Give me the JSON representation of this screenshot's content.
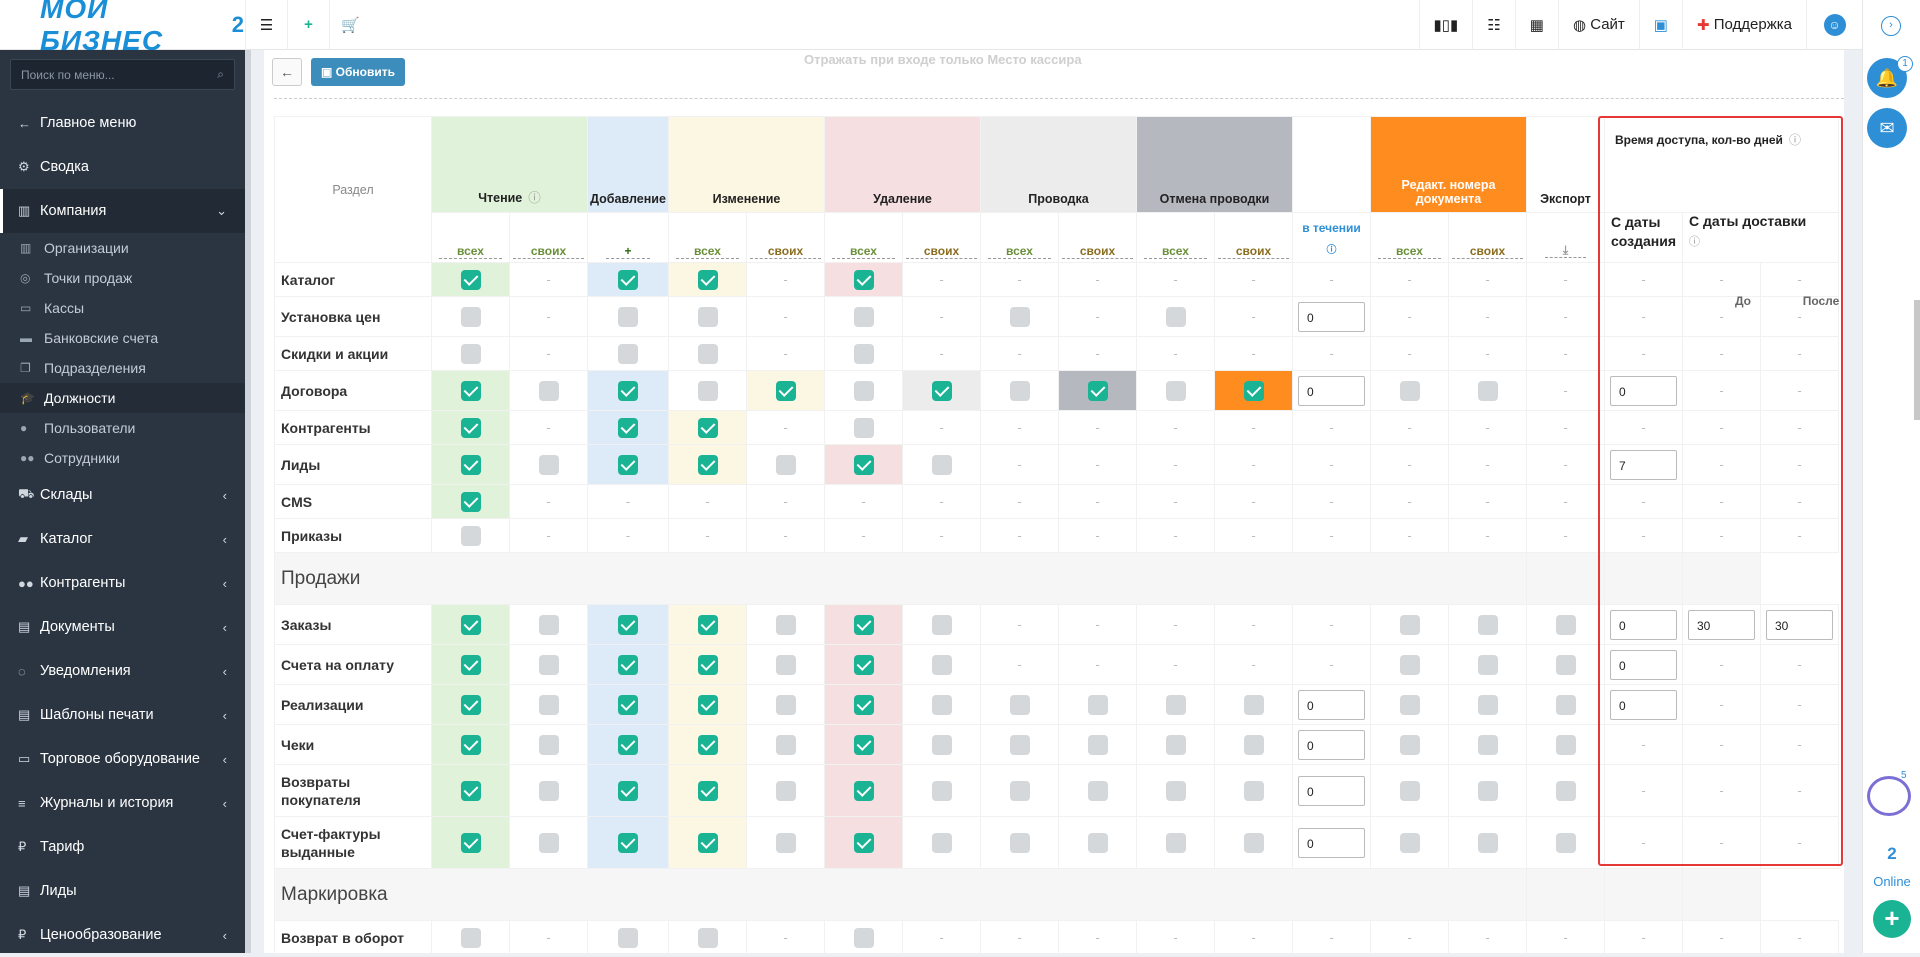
{
  "topbar": {
    "logo_text": "МОЙ БИЗНЕС",
    "logo_num": "2",
    "site": "Сайт",
    "support": "Поддержка"
  },
  "sidebar": {
    "search_placeholder": "Поиск по меню...",
    "items": [
      {
        "label": "Главное меню",
        "icon": "arrow-left-icon"
      },
      {
        "label": "Сводка",
        "icon": "gear-icon"
      },
      {
        "label": "Компания",
        "icon": "chart-icon",
        "active": true
      }
    ],
    "subitems": [
      {
        "label": "Организации",
        "icon": "building-icon"
      },
      {
        "label": "Точки продаж",
        "icon": "target-icon"
      },
      {
        "label": "Кассы",
        "icon": "cash-icon"
      },
      {
        "label": "Банковские счета",
        "icon": "card-icon"
      },
      {
        "label": "Подразделения",
        "icon": "copy-icon"
      },
      {
        "label": "Должности",
        "icon": "graduation-icon",
        "active": true
      },
      {
        "label": "Пользователи",
        "icon": "user-icon"
      },
      {
        "label": "Сотрудники",
        "icon": "users-icon"
      }
    ],
    "items2": [
      {
        "label": "Склады",
        "icon": "truck-icon"
      },
      {
        "label": "Каталог",
        "icon": "folder-icon"
      },
      {
        "label": "Контрагенты",
        "icon": "users-icon"
      },
      {
        "label": "Документы",
        "icon": "document-icon"
      },
      {
        "label": "Уведомления",
        "icon": "chat-icon"
      },
      {
        "label": "Шаблоны печати",
        "icon": "template-icon"
      },
      {
        "label": "Торговое оборудование",
        "icon": "inbox-icon"
      },
      {
        "label": "Журналы и история",
        "icon": "list-icon"
      },
      {
        "label": "Тариф",
        "icon": "ruble-icon"
      },
      {
        "label": "Лиды",
        "icon": "document-icon"
      },
      {
        "label": "Ценообразование",
        "icon": "ruble-icon"
      }
    ]
  },
  "toolbar": {
    "refresh": "Обновить",
    "faded": "Отражать при входе только Место кассира"
  },
  "table": {
    "h_section": "Раздел",
    "h_read": "Чтение",
    "h_add": "Добавление",
    "h_edit": "Изменение",
    "h_del": "Удаление",
    "h_post": "Проводка",
    "h_unpost": "Отмена проводки",
    "h_renum": "Редакт. номера документа",
    "h_export": "Экспорт",
    "h_access": "Время доступа, кол-во дней",
    "h_created": "С даты создания",
    "h_delivery": "С даты доставки",
    "s_all": "всех",
    "s_own": "своих",
    "s_within": "в течении",
    "s_before": "До",
    "s_after": "После",
    "dash": "-",
    "sections": [
      {
        "name": "",
        "rows": [
          {
            "label": "Каталог",
            "cells": [
              "g1",
              "-",
              "b1",
              "y1",
              "-",
              "p1",
              "-",
              "-",
              "-",
              "-",
              "-",
              "-",
              "-",
              "-",
              "-",
              "-",
              "-",
              "-"
            ]
          },
          {
            "label": "Установка цен",
            "cells": [
              "0",
              "-",
              "0",
              "0",
              "-",
              "0",
              "-",
              "0",
              "-",
              "0",
              "-",
              "i:0",
              "-",
              "-",
              "-",
              "-",
              "-",
              "-"
            ]
          },
          {
            "label": "Скидки и акции",
            "cells": [
              "0",
              "-",
              "0",
              "0",
              "-",
              "0",
              "-",
              "-",
              "-",
              "-",
              "-",
              "-",
              "-",
              "-",
              "-",
              "-",
              "-",
              "-"
            ]
          },
          {
            "label": "Договора",
            "cells": [
              "g1",
              "0",
              "b1",
              "0",
              "y1",
              "0",
              "gr1",
              "0",
              "dg1",
              "0",
              "o1",
              "i:0",
              "0",
              "0",
              "-",
              "i:0",
              "-",
              "-"
            ]
          },
          {
            "label": "Контрагенты",
            "cells": [
              "g1",
              "-",
              "b1",
              "y1",
              "-",
              "0",
              "-",
              "-",
              "-",
              "-",
              "-",
              "-",
              "-",
              "-",
              "-",
              "-",
              "-",
              "-"
            ]
          },
          {
            "label": "Лиды",
            "cells": [
              "g1",
              "0",
              "b1",
              "y1",
              "0",
              "p1",
              "0",
              "-",
              "-",
              "-",
              "-",
              "-",
              "-",
              "-",
              "-",
              "i:7",
              "-",
              "-"
            ]
          },
          {
            "label": "CMS",
            "cells": [
              "g1",
              "-",
              "-",
              "-",
              "-",
              "-",
              "-",
              "-",
              "-",
              "-",
              "-",
              "-",
              "-",
              "-",
              "-",
              "-",
              "-",
              "-"
            ]
          },
          {
            "label": "Приказы",
            "cells": [
              "0",
              "-",
              "-",
              "-",
              "-",
              "-",
              "-",
              "-",
              "-",
              "-",
              "-",
              "-",
              "-",
              "-",
              "-",
              "-",
              "-",
              "-"
            ]
          }
        ]
      },
      {
        "name": "Продажи",
        "rows": [
          {
            "label": "Заказы",
            "cells": [
              "g1",
              "0",
              "b1",
              "y1",
              "0",
              "p1",
              "0",
              "-",
              "-",
              "-",
              "-",
              "-",
              "0",
              "0",
              "0",
              "i:0",
              "i:30",
              "i:30"
            ]
          },
          {
            "label": "Счета на оплату",
            "cells": [
              "g1",
              "0",
              "b1",
              "y1",
              "0",
              "p1",
              "0",
              "-",
              "-",
              "-",
              "-",
              "-",
              "0",
              "0",
              "0",
              "i:0",
              "-",
              "-"
            ]
          },
          {
            "label": "Реализации",
            "cells": [
              "g1",
              "0",
              "b1",
              "y1",
              "0",
              "p1",
              "0",
              "0",
              "0",
              "0",
              "0",
              "i:0",
              "0",
              "0",
              "0",
              "i:0",
              "-",
              "-"
            ]
          },
          {
            "label": "Чеки",
            "cells": [
              "g1",
              "0",
              "b1",
              "y1",
              "0",
              "p1",
              "0",
              "0",
              "0",
              "0",
              "0",
              "i:0",
              "0",
              "0",
              "0",
              "-",
              "-",
              "-"
            ]
          },
          {
            "label": "Возвраты покупателя",
            "cells": [
              "g1",
              "0",
              "b1",
              "y1",
              "0",
              "p1",
              "0",
              "0",
              "0",
              "0",
              "0",
              "i:0",
              "0",
              "0",
              "0",
              "-",
              "-",
              "-"
            ]
          },
          {
            "label": "Счет-фактуры выданные",
            "cells": [
              "g1",
              "0",
              "b1",
              "y1",
              "0",
              "p1",
              "0",
              "0",
              "0",
              "0",
              "0",
              "i:0",
              "0",
              "0",
              "0",
              "-",
              "-",
              "-"
            ]
          }
        ]
      },
      {
        "name": "Маркировка",
        "rows": [
          {
            "label": "Возврат в оборот",
            "cells": [
              "0",
              "-",
              "0",
              "0",
              "-",
              "0",
              "-",
              "-",
              "-",
              "-",
              "-",
              "-",
              "-",
              "-",
              "-",
              "-",
              "-",
              "-"
            ]
          }
        ]
      }
    ]
  },
  "rightbar": {
    "notif_count": "1",
    "bot_count": "5",
    "online_count": "2",
    "online_label": "Online"
  }
}
